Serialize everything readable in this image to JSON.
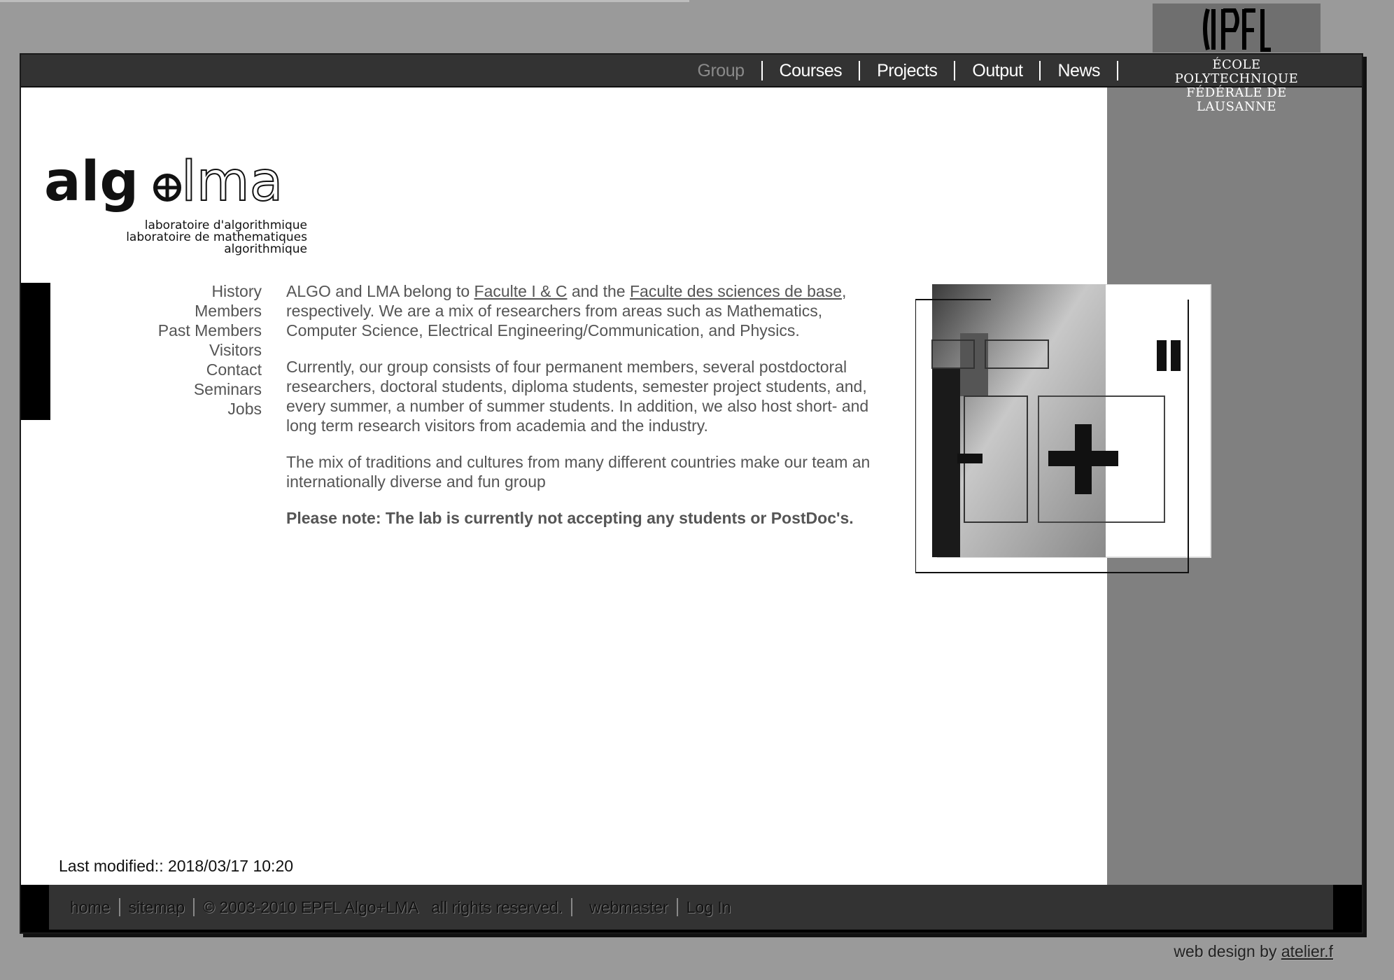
{
  "nav": {
    "items": [
      {
        "label": "Group",
        "active": true
      },
      {
        "label": "Courses",
        "active": false
      },
      {
        "label": "Projects",
        "active": false
      },
      {
        "label": "Output",
        "active": false
      },
      {
        "label": "News",
        "active": false
      }
    ]
  },
  "epfl": {
    "line1": "ÉCOLE POLYTECHNIQUE",
    "line2": "FÉDÉRALE DE LAUSANNE"
  },
  "logo": {
    "sub1": "laboratoire d'algorithmique",
    "sub2": "laboratoire de mathematiques algorithmique"
  },
  "sidebar": {
    "items": [
      "History",
      "Members",
      "Past Members",
      "Visitors",
      "Contact",
      "Seminars",
      "Jobs"
    ]
  },
  "content": {
    "p1_a": "ALGO and LMA belong to ",
    "p1_link1": "Faculte I & C",
    "p1_b": " and the ",
    "p1_link2": "Faculte des sciences de base",
    "p1_c": ", respectively. We are a mix of researchers from areas such as Mathematics, Computer Science, Electrical Engineering/Communication, and Physics.",
    "p2": "Currently, our group consists of four permanent members, several postdoctoral researchers, doctoral students, diploma students, semester project students, and, every summer, a number of summer students. In addition, we also host short- and long term research visitors from academia and the industry.",
    "p3": "The mix of traditions and cultures from many different countries make our team an internationally diverse and fun group",
    "note": "Please note: The lab is currently not accepting any students or PostDoc's."
  },
  "last_modified": "Last modified:: 2018/03/17 10:20",
  "footer": {
    "home": "home",
    "sitemap": "sitemap",
    "copyright": "© 2003-2010 EPFL Algo+LMA   all rights reserved.",
    "webmaster": "webmaster",
    "login": "Log In"
  },
  "credit": {
    "prefix": "web design by ",
    "link": "atelier.f"
  }
}
